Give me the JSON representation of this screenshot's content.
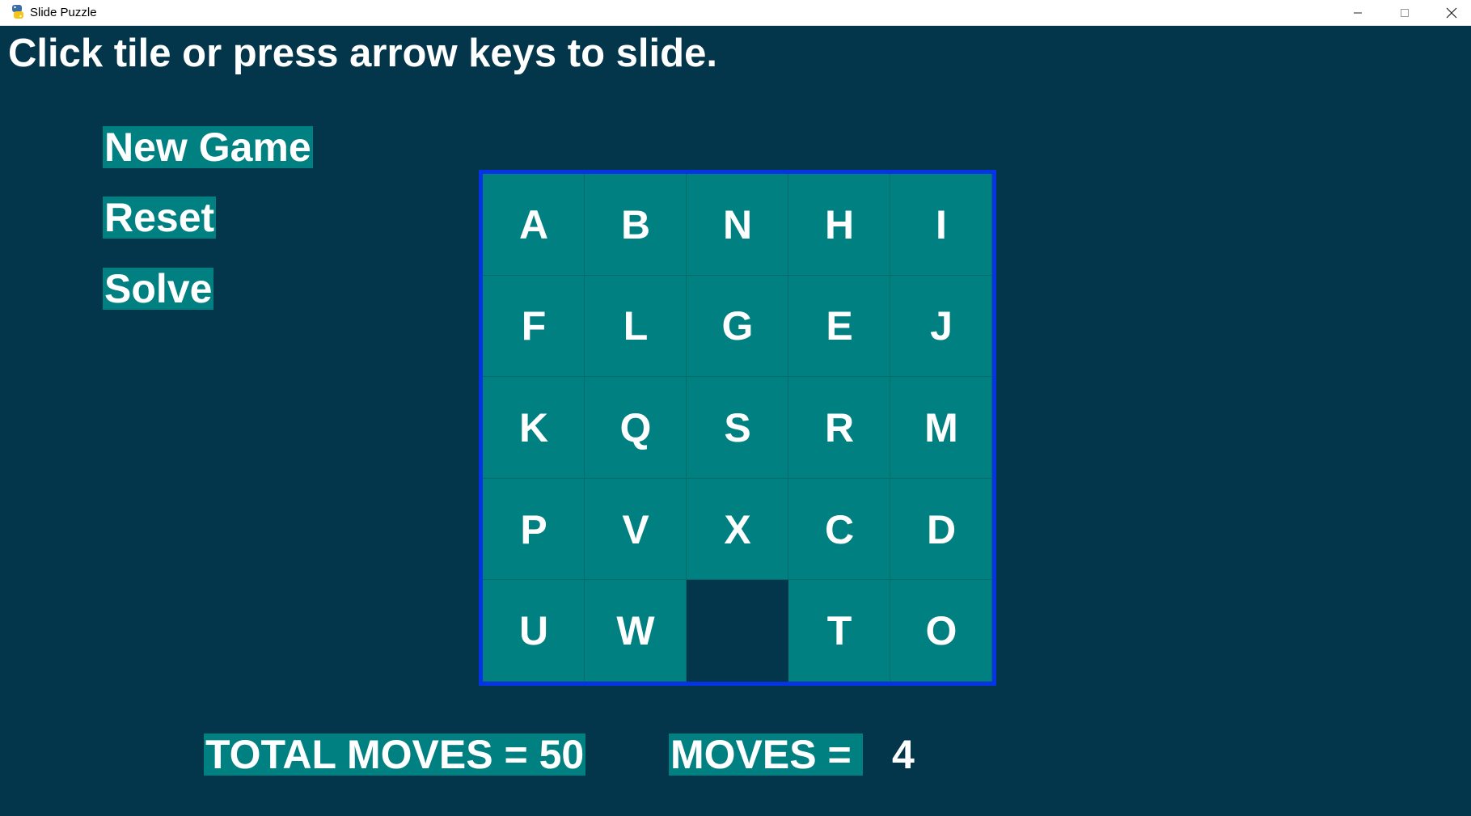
{
  "window": {
    "title": "Slide Puzzle",
    "icon": "python-icon",
    "controls": {
      "minimize": "minimize-icon",
      "maximize": "maximize-icon",
      "close": "close-icon"
    }
  },
  "instruction": "Click tile or press arrow keys to slide.",
  "menu": {
    "new_game": "New Game",
    "reset": "Reset",
    "solve": "Solve"
  },
  "board": {
    "rows": [
      [
        "A",
        "B",
        "N",
        "H",
        "I"
      ],
      [
        "F",
        "L",
        "G",
        "E",
        "J"
      ],
      [
        "K",
        "Q",
        "S",
        "R",
        "M"
      ],
      [
        "P",
        "V",
        "X",
        "C",
        "D"
      ],
      [
        "U",
        "W",
        "",
        "T",
        "O"
      ]
    ]
  },
  "stats": {
    "total_moves_label": "TOTAL MOVES = 50",
    "moves_label": "MOVES =",
    "moves_value": "4"
  },
  "colors": {
    "background": "#03364a",
    "tile": "#008080",
    "board_border": "#0533e6",
    "text": "#ffffff"
  }
}
